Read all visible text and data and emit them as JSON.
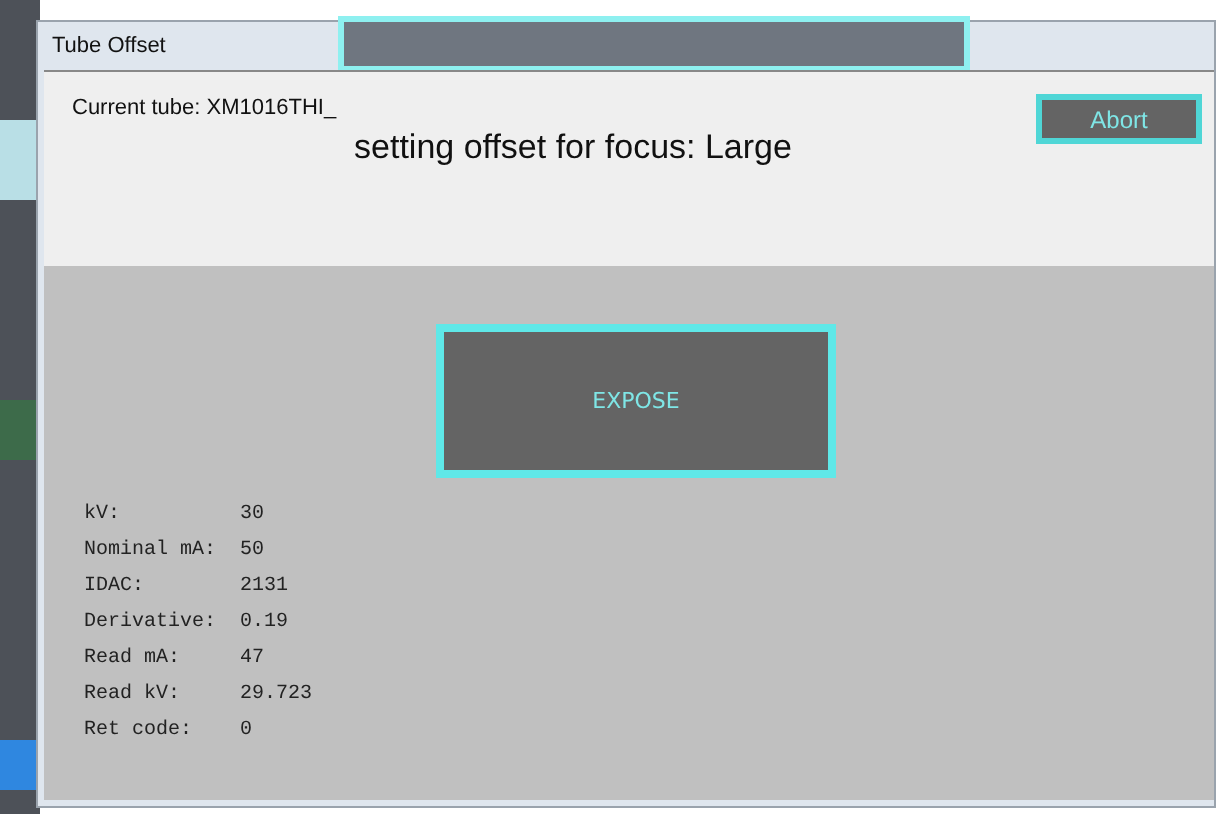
{
  "window": {
    "title": "Tube Offset"
  },
  "header": {
    "current_tube": "Current tube: XM1016THI_",
    "status": "setting offset for focus: Large",
    "abort_button": "Abort"
  },
  "expose_button": "EXPOSE",
  "readings": [
    {
      "label": "kV:",
      "value": "30"
    },
    {
      "label": "Nominal mA:",
      "value": "50"
    },
    {
      "label": "IDAC:",
      "value": "2131"
    },
    {
      "label": "Derivative:",
      "value": "0.19"
    },
    {
      "label": "Read mA:",
      "value": "47"
    },
    {
      "label": "Read kV:",
      "value": "29.723"
    },
    {
      "label": "Ret code:",
      "value": "0"
    }
  ]
}
